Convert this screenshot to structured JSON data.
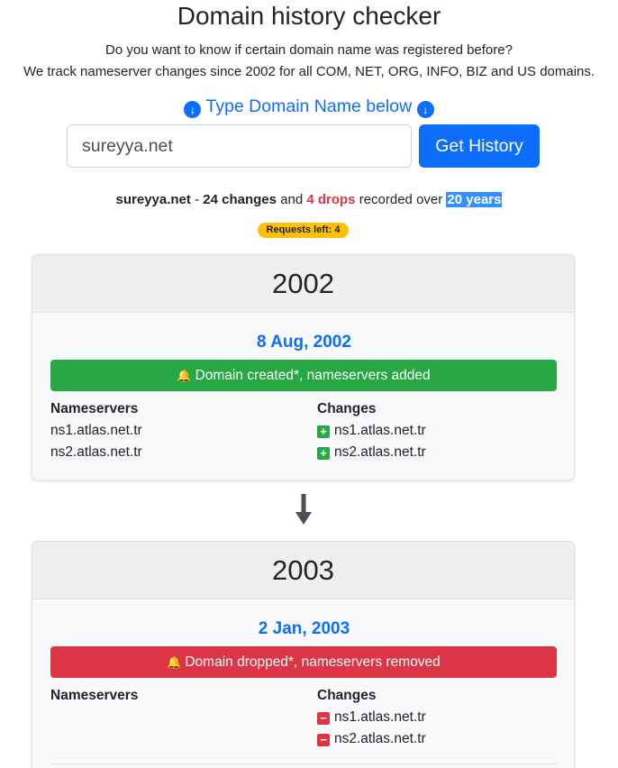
{
  "header": {
    "title": "Domain history checker",
    "intro_line1": "Do you want to know if certain domain name was registered before?",
    "intro_line2": "We track nameserver changes since 2002 for all COM, NET, ORG, INFO, BIZ and US domains."
  },
  "search": {
    "prompt": "Type Domain Name below",
    "value": "sureyya.net",
    "button_label": "Get History"
  },
  "summary": {
    "domain": "sureyya.net",
    "sep": " - ",
    "changes": "24 changes",
    "and": " and ",
    "drops": "4 drops",
    "recorded": " recorded over ",
    "years": "20 years"
  },
  "requests_badge": "Requests left: 4",
  "timeline": [
    {
      "year": "2002",
      "date": "8 Aug, 2002",
      "event": "Domain created*, nameservers added",
      "status_color": "#28a745",
      "nameservers_label": "Nameservers",
      "changes_label": "Changes",
      "nameservers": [
        "ns1.atlas.net.tr",
        "ns2.atlas.net.tr"
      ],
      "changes": [
        {
          "type": "added",
          "icon": "plus-square-icon",
          "value": "ns1.atlas.net.tr"
        },
        {
          "type": "added",
          "icon": "plus-square-icon",
          "value": "ns2.atlas.net.tr"
        }
      ]
    },
    {
      "year": "2003",
      "date": "2 Jan, 2003",
      "event": "Domain dropped*, nameservers removed",
      "status_color": "#dc3545",
      "nameservers_label": "Nameservers",
      "changes_label": "Changes",
      "nameservers": [],
      "changes": [
        {
          "type": "removed",
          "icon": "minus-square-icon",
          "value": "ns1.atlas.net.tr"
        },
        {
          "type": "removed",
          "icon": "minus-square-icon",
          "value": "ns2.atlas.net.tr"
        }
      ]
    }
  ],
  "colors": {
    "primary": "#0d6efd",
    "success": "#28a745",
    "danger": "#dc3545",
    "warning": "#ffc107"
  }
}
